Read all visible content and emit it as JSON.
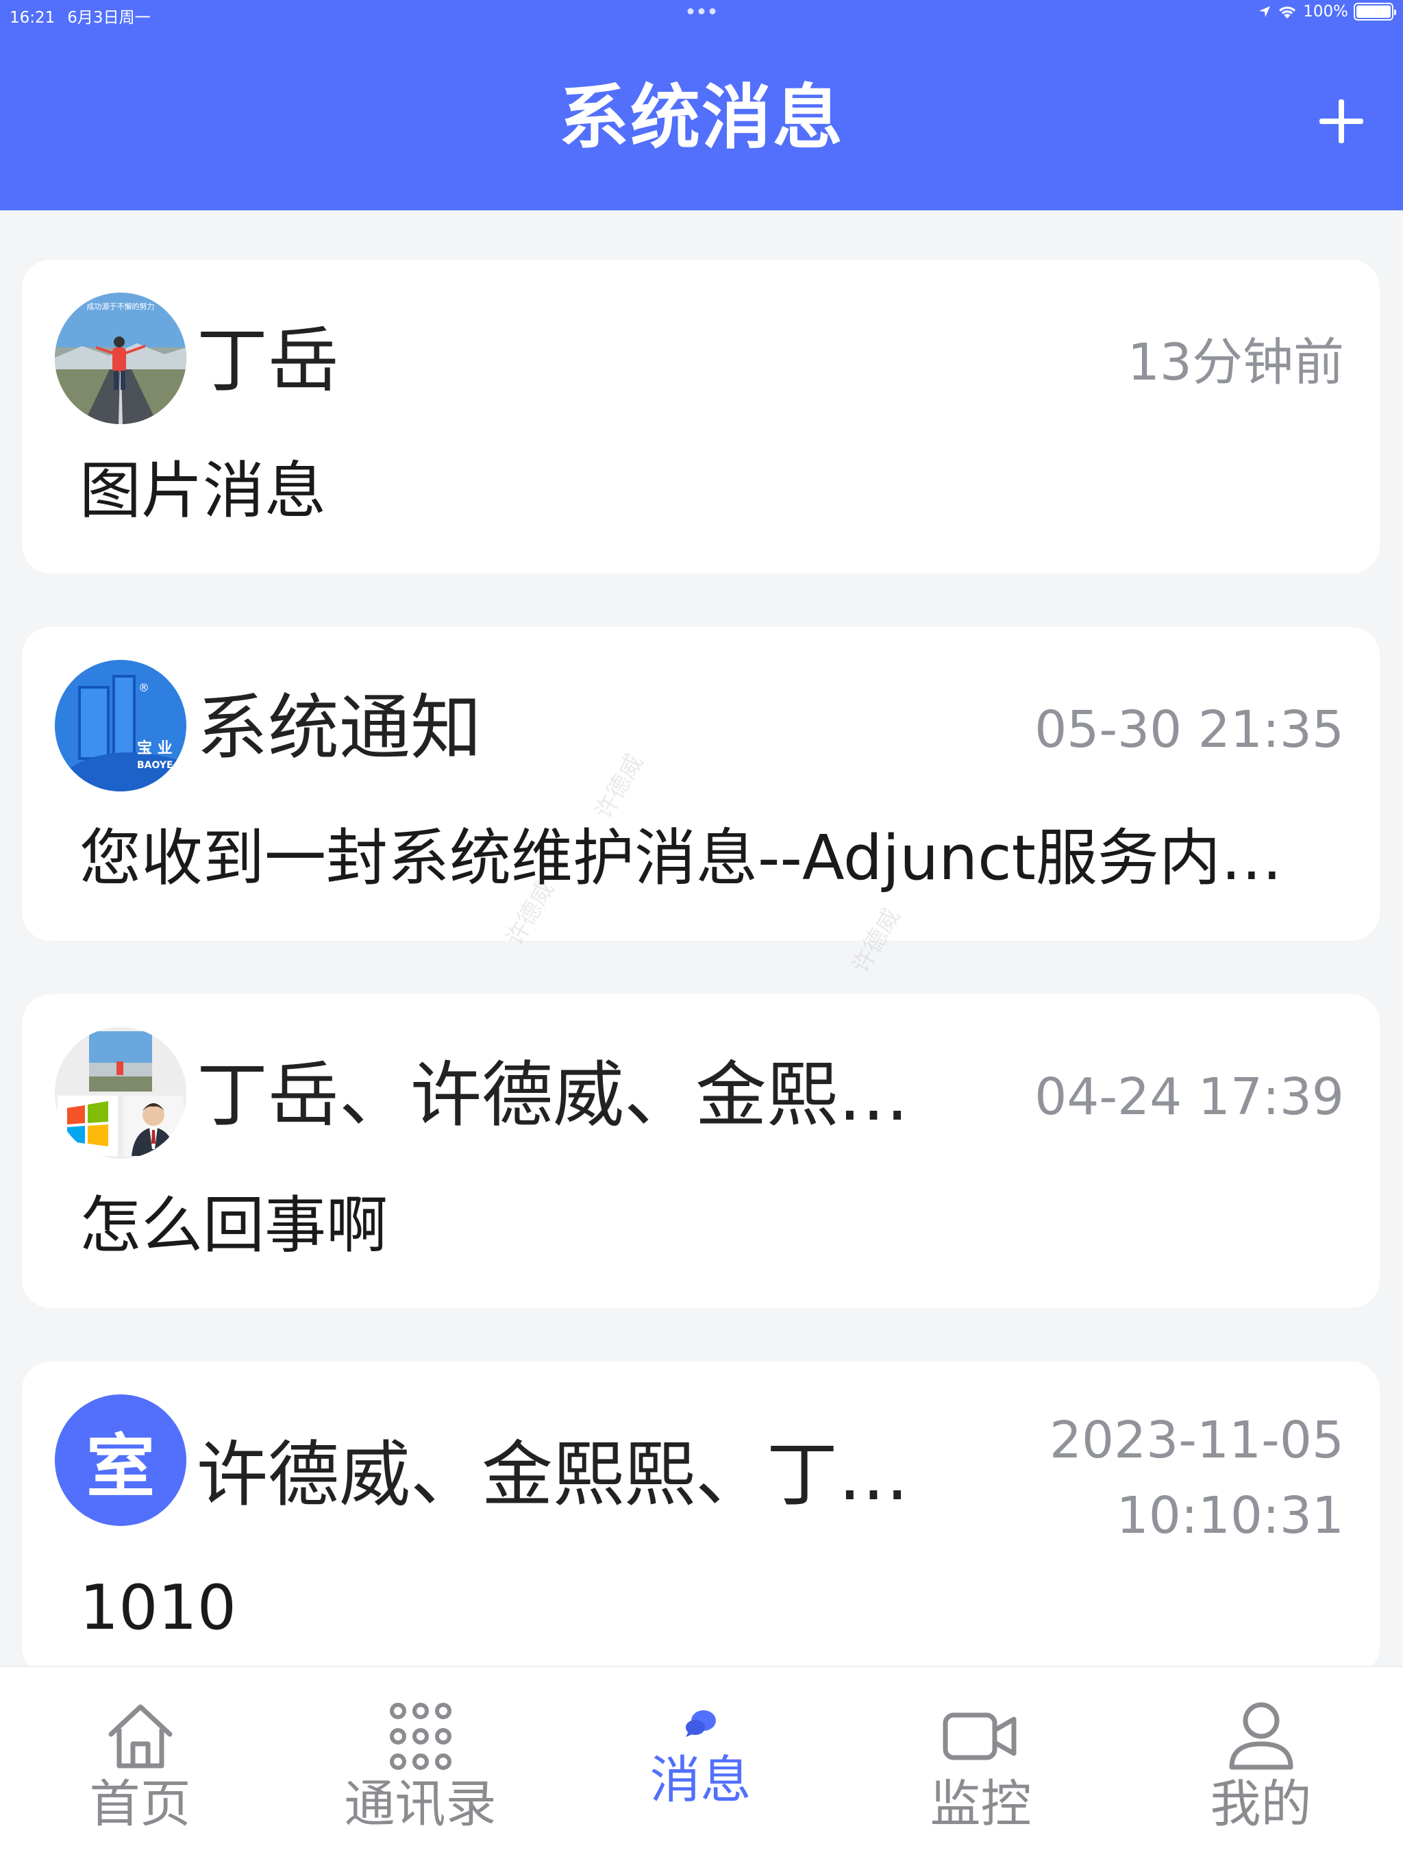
{
  "status_bar": {
    "time": "16:21",
    "date": "6月3日周一",
    "battery": "100%"
  },
  "header": {
    "title": "系统消息",
    "add_icon": "plus-icon"
  },
  "messages": [
    {
      "name": "丁岳",
      "time": "13分钟前",
      "preview": "图片消息",
      "avatar": "photo",
      "avatar_caption": "成功源于不懈的努力"
    },
    {
      "name": "系统通知",
      "time": "05-30 21:35",
      "preview": "您收到一封系统维护消息--Adjunct服务内存…",
      "avatar": "logo",
      "logo_cn": "宝 业",
      "logo_en": "BAOYE"
    },
    {
      "name": "丁岳、许德威、金熙…",
      "time": "04-24 17:39",
      "preview": "怎么回事啊",
      "avatar": "group"
    },
    {
      "name": "许德威、金熙熙、丁…",
      "time_line1": "2023-11-05",
      "time_line2": "10:10:31",
      "preview": "1010",
      "avatar": "letter",
      "avatar_letter": "室"
    }
  ],
  "watermark_text": "许德威",
  "tabs": [
    {
      "label": "首页",
      "icon": "home-icon",
      "active": false
    },
    {
      "label": "通讯录",
      "icon": "grid-icon",
      "active": false
    },
    {
      "label": "消息",
      "icon": "chat-bubble-icon",
      "active": true
    },
    {
      "label": "监控",
      "icon": "video-camera-icon",
      "active": false
    },
    {
      "label": "我的",
      "icon": "person-icon",
      "active": false
    }
  ],
  "colors": {
    "primary": "#5270fb",
    "background": "#f4f5f7",
    "text": "#222222",
    "muted": "#909399",
    "tab_inactive": "#8a8c90"
  }
}
